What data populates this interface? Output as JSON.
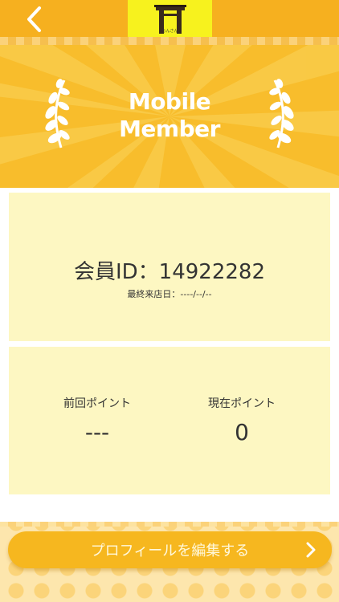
{
  "header": {
    "logo_text": "ちんさん"
  },
  "hero": {
    "title": "Mobile\nMember"
  },
  "member": {
    "id_line": "会員ID：14922282",
    "last_visit": "最終来店日：----/--/--"
  },
  "points": {
    "previous_label": "前回ポイント",
    "previous_value": "---",
    "current_label": "現在ポイント",
    "current_value": "0"
  },
  "footer": {
    "edit_label": "プロフィールを編集する"
  },
  "colors": {
    "accent": "#f6b01f",
    "logo_bg": "#f7f21e",
    "card_bg": "#fdf7c2"
  },
  "icons": {
    "back": "chevron-left-icon",
    "laurel": "laurel-icon",
    "next": "chevron-right-icon"
  }
}
